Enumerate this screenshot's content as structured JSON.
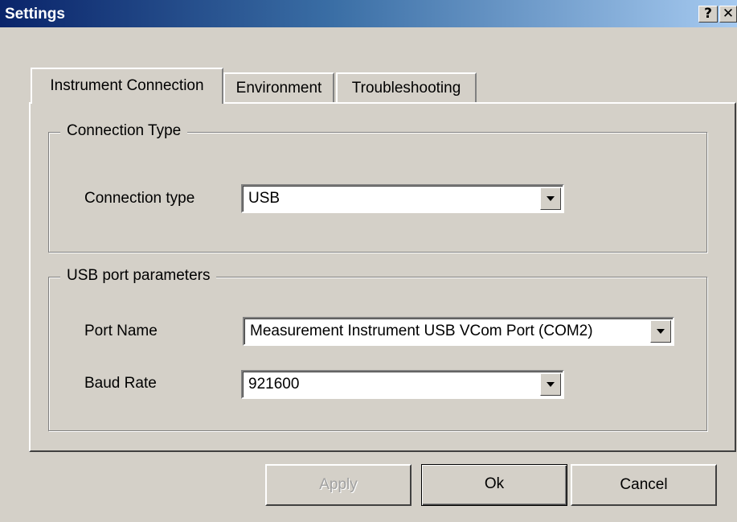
{
  "window": {
    "title": "Settings",
    "help_label": "?",
    "close_label": "✕"
  },
  "tabs": [
    {
      "label": "Instrument Connection",
      "active": true
    },
    {
      "label": "Environment",
      "active": false
    },
    {
      "label": "Troubleshooting",
      "active": false
    }
  ],
  "connection_group": {
    "legend": "Connection Type",
    "connection_type_label": "Connection type",
    "connection_type_value": "USB"
  },
  "usb_group": {
    "legend": "USB port parameters",
    "port_name_label": "Port Name",
    "port_name_value": "Measurement Instrument USB VCom Port (COM2)",
    "baud_rate_label": "Baud Rate",
    "baud_rate_value": "921600"
  },
  "buttons": {
    "apply_label": "Apply",
    "ok_label": "Ok",
    "cancel_label": "Cancel",
    "apply_enabled": false
  },
  "colors": {
    "face": "#d4d0c8",
    "title_start": "#0a246a",
    "title_end": "#a6caf0"
  },
  "icons": {
    "help": "help-icon",
    "close": "close-icon",
    "dropdown": "chevron-down-icon"
  }
}
